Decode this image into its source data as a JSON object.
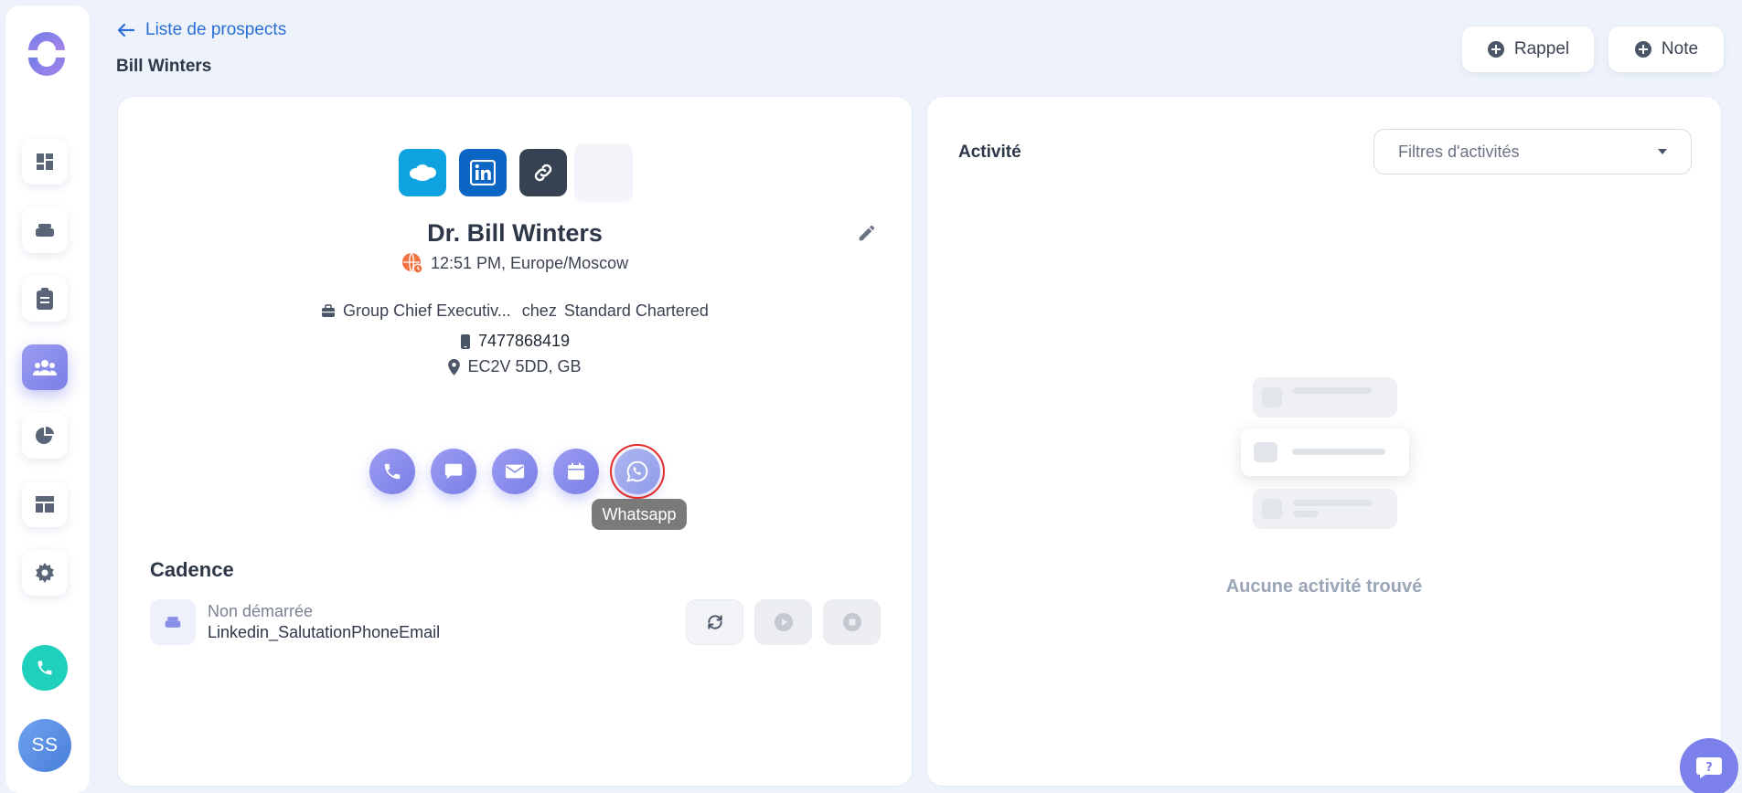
{
  "header": {
    "back_label": "Liste de prospects",
    "page_title": "Bill Winters",
    "rappel_label": "Rappel",
    "note_label": "Note"
  },
  "sidebar": {
    "items": [
      {
        "icon": "dashboard-icon"
      },
      {
        "icon": "layers-icon"
      },
      {
        "icon": "clipboard-icon"
      },
      {
        "icon": "users-icon",
        "active": true
      },
      {
        "icon": "pie-chart-icon"
      },
      {
        "icon": "template-icon"
      },
      {
        "icon": "gear-icon"
      }
    ],
    "avatar_initials": "SS"
  },
  "prospect": {
    "name": "Dr. Bill Winters",
    "time_zone": "12:51 PM, Europe/Moscow",
    "job_title": "Group Chief Executiv...",
    "at_label": "chez",
    "company": "Standard Chartered",
    "phone": "7477868419",
    "location": "EC2V 5DD, GB"
  },
  "actions": {
    "tooltip": "Whatsapp"
  },
  "cadence": {
    "title": "Cadence",
    "status": "Non démarrée",
    "name": "Linkedin_SalutationPhoneEmail"
  },
  "activity": {
    "title": "Activité",
    "filter_placeholder": "Filtres d'activités",
    "empty_text": "Aucune activité trouvé"
  },
  "colors": {
    "accent": "#7b7fe6",
    "link": "#2b6fd6",
    "salesforce": "#0ea2e0",
    "linkedin": "#0a66c2",
    "link_dark": "#364152",
    "call_teal": "#1fd1bd"
  }
}
